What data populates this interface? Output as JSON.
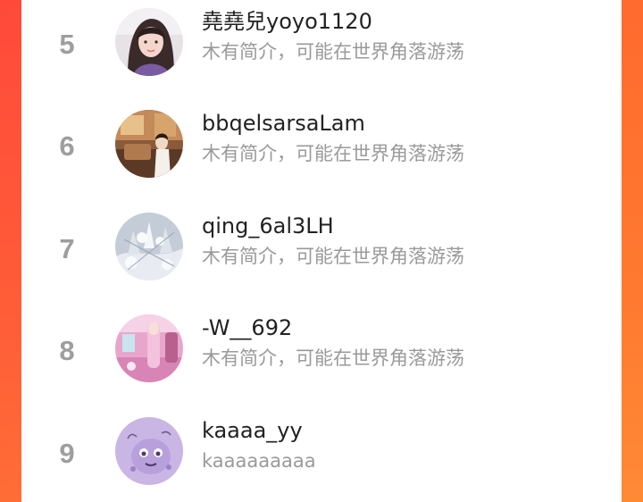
{
  "users": [
    {
      "rank": "5",
      "name": "堯堯兒yoyo1120",
      "bio": "木有简介，可能在世界角落游荡"
    },
    {
      "rank": "6",
      "name": "bbqelsarsaLam",
      "bio": "木有简介，可能在世界角落游荡"
    },
    {
      "rank": "7",
      "name": "qing_6al3LH",
      "bio": "木有简介，可能在世界角落游荡"
    },
    {
      "rank": "8",
      "name": "-W__692",
      "bio": "木有简介，可能在世界角落游荡"
    },
    {
      "rank": "9",
      "name": "kaaaa_yy",
      "bio": "kaaaaaaaaa"
    }
  ],
  "colors": {
    "background_accent": "#ff6b3a",
    "rank_text": "#9e9e9e",
    "name_text": "#222222",
    "bio_text": "#9a9a9a"
  }
}
